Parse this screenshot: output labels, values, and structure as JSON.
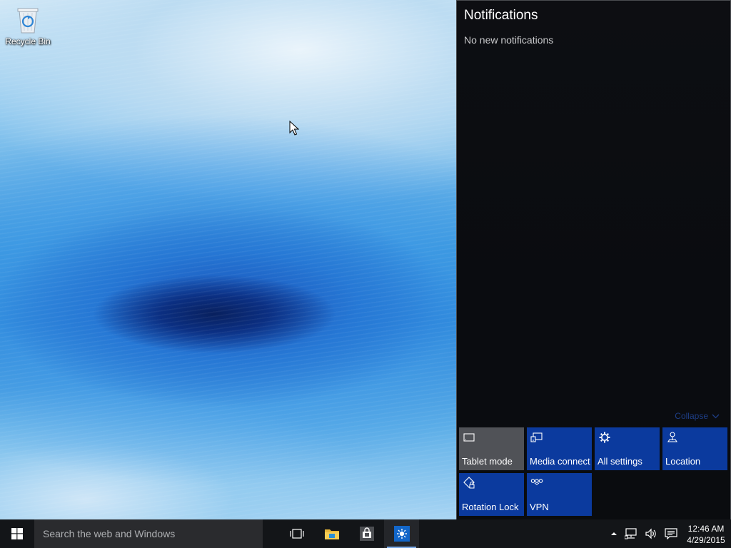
{
  "desktop": {
    "icons": [
      {
        "label": "Recycle Bin",
        "icon": "recycle-bin-icon"
      }
    ]
  },
  "action_center": {
    "title": "Notifications",
    "empty_message": "No new notifications",
    "collapse_label": "Collapse",
    "quick_actions": [
      {
        "label": "Tablet mode",
        "icon": "tablet-mode-icon",
        "state": "off"
      },
      {
        "label": "Media connect",
        "icon": "media-connect-icon",
        "state": "on"
      },
      {
        "label": "All settings",
        "icon": "gear-icon",
        "state": "on"
      },
      {
        "label": "Location",
        "icon": "location-icon",
        "state": "on"
      },
      {
        "label": "Rotation Lock",
        "icon": "rotation-lock-icon",
        "state": "on"
      },
      {
        "label": "VPN",
        "icon": "vpn-icon",
        "state": "on"
      }
    ]
  },
  "taskbar": {
    "search_placeholder": "Search the web and Windows",
    "apps": [
      {
        "name": "Task View",
        "icon": "task-view-icon"
      },
      {
        "name": "File Explorer",
        "icon": "file-explorer-icon"
      },
      {
        "name": "Store",
        "icon": "store-icon"
      },
      {
        "name": "Settings",
        "icon": "settings-app-icon",
        "active": true
      }
    ],
    "tray": {
      "icons": [
        "chevron-up-icon",
        "network-icon",
        "volume-icon",
        "action-center-icon"
      ],
      "time": "12:46 AM",
      "date": "4/29/2015"
    }
  },
  "colors": {
    "accent": "#0b3a9e",
    "tile_off": "#505257",
    "taskbar": "#131518",
    "action_center_bg": "#0d0e12"
  }
}
